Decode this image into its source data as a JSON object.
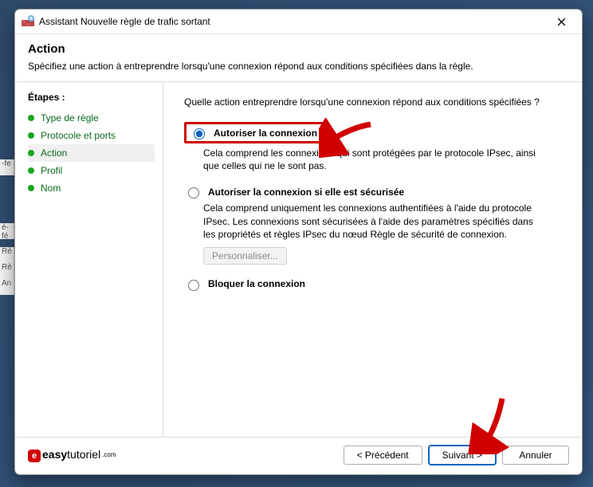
{
  "window": {
    "title": "Assistant Nouvelle règle de trafic sortant"
  },
  "header": {
    "title": "Action",
    "subtitle": "Spécifiez une action à entreprendre lorsqu'une connexion répond aux conditions spécifiées dans la règle."
  },
  "steps": {
    "title": "Étapes :",
    "items": [
      {
        "label": "Type de règle"
      },
      {
        "label": "Protocole et ports"
      },
      {
        "label": "Action"
      },
      {
        "label": "Profil"
      },
      {
        "label": "Nom"
      }
    ]
  },
  "content": {
    "question": "Quelle action entreprendre lorsqu'une connexion répond aux conditions spécifiées ?",
    "options": [
      {
        "id": "allow",
        "label": "Autoriser la connexion",
        "desc": "Cela comprend les connexions qui sont protégées par le protocole IPsec, ainsi que celles qui ne le sont pas."
      },
      {
        "id": "allow-secure",
        "label": "Autoriser la connexion si elle est sécurisée",
        "desc": "Cela comprend uniquement les connexions authentifiées à l'aide du protocole IPsec. Les connexions sont sécurisées à l'aide des paramètres spécifiés dans les propriétés et règles IPsec du nœud Règle de sécurité de connexion.",
        "customize": "Personnaliser..."
      },
      {
        "id": "block",
        "label": "Bloquer la connexion"
      }
    ]
  },
  "footer": {
    "logo_strong": "easy",
    "logo_thin": "tutoriel",
    "logo_sub": ".com",
    "back": "< Précédent",
    "next": "Suivant >",
    "cancel": "Annuler"
  },
  "bg_labels": [
    "-fe",
    "è-fé",
    "Rè",
    "Rè",
    "An"
  ]
}
